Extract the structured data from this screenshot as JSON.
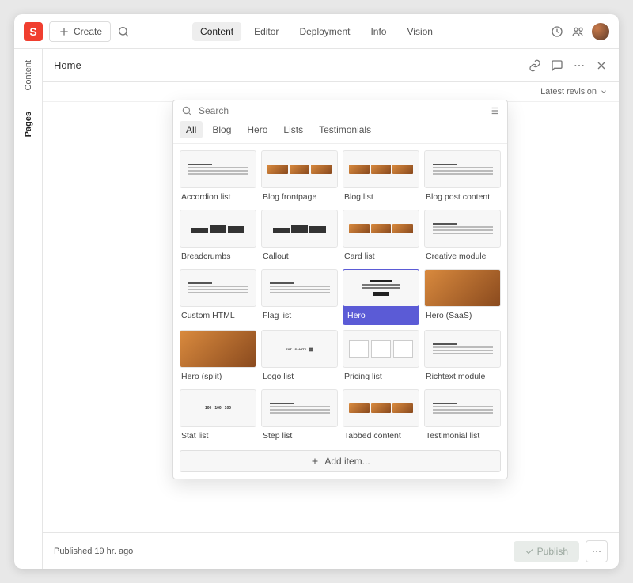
{
  "logoLetter": "S",
  "create": "Create",
  "nav": {
    "content": "Content",
    "editor": "Editor",
    "deployment": "Deployment",
    "info": "Info",
    "vision": "Vision"
  },
  "sidetabs": {
    "content": "Content",
    "pages": "Pages"
  },
  "doc": {
    "title": "Home",
    "revision": "Latest revision"
  },
  "picker": {
    "searchPlaceholder": "Search",
    "tabs": {
      "all": "All",
      "blog": "Blog",
      "hero": "Hero",
      "lists": "Lists",
      "testimonials": "Testimonials"
    },
    "addItem": "Add item...",
    "items": [
      {
        "label": "Accordion list",
        "sel": false,
        "art": "lines"
      },
      {
        "label": "Blog frontpage",
        "sel": false,
        "art": "tiles"
      },
      {
        "label": "Blog list",
        "sel": false,
        "art": "tiles"
      },
      {
        "label": "Blog post content",
        "sel": false,
        "art": "lines"
      },
      {
        "label": "Breadcrumbs",
        "sel": false,
        "art": "bars"
      },
      {
        "label": "Callout",
        "sel": false,
        "art": "bars"
      },
      {
        "label": "Card list",
        "sel": false,
        "art": "tiles"
      },
      {
        "label": "Creative module",
        "sel": false,
        "art": "lines"
      },
      {
        "label": "Custom HTML",
        "sel": false,
        "art": "lines"
      },
      {
        "label": "Flag list",
        "sel": false,
        "art": "lines"
      },
      {
        "label": "Hero",
        "sel": true,
        "art": "hero"
      },
      {
        "label": "Hero (SaaS)",
        "sel": false,
        "art": "dog"
      },
      {
        "label": "Hero (split)",
        "sel": false,
        "art": "dog"
      },
      {
        "label": "Logo list",
        "sel": false,
        "art": "logos"
      },
      {
        "label": "Pricing list",
        "sel": false,
        "art": "cols"
      },
      {
        "label": "Richtext module",
        "sel": false,
        "art": "lines"
      },
      {
        "label": "Stat list",
        "sel": false,
        "art": "nums"
      },
      {
        "label": "Step list",
        "sel": false,
        "art": "lines"
      },
      {
        "label": "Tabbed content",
        "sel": false,
        "art": "tiles"
      },
      {
        "label": "Testimonial list",
        "sel": false,
        "art": "lines"
      }
    ]
  },
  "footer": {
    "published": "Published 19 hr. ago",
    "publish": "Publish"
  }
}
